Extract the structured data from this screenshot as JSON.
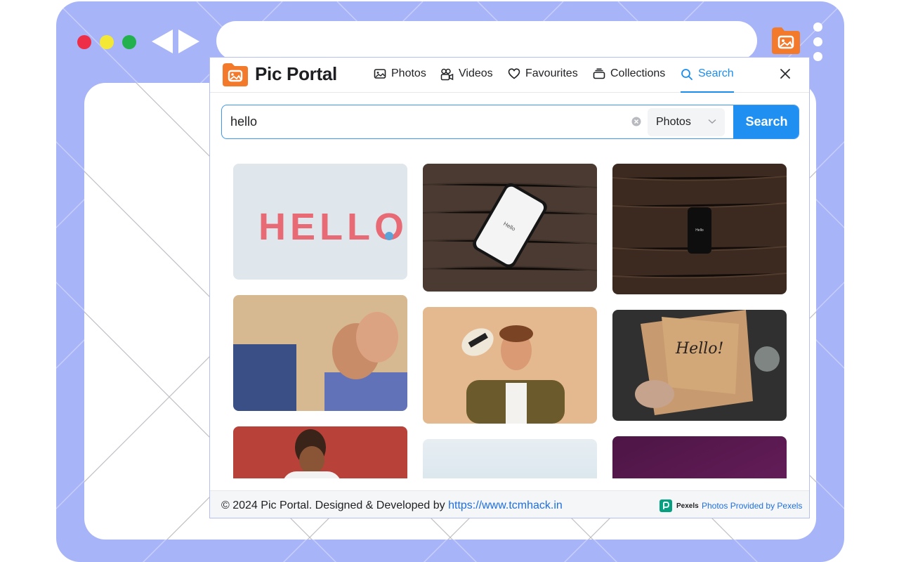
{
  "app": {
    "title": "Pic Portal"
  },
  "nav": {
    "tabs": [
      {
        "label": "Photos",
        "icon": "photo-icon",
        "active": false
      },
      {
        "label": "Videos",
        "icon": "video-icon",
        "active": false
      },
      {
        "label": "Favourites",
        "icon": "heart-icon",
        "active": false
      },
      {
        "label": "Collections",
        "icon": "collection-icon",
        "active": false
      },
      {
        "label": "Search",
        "icon": "search-icon",
        "active": true
      }
    ]
  },
  "search": {
    "query": "hello",
    "type_selected": "Photos",
    "button_label": "Search"
  },
  "results": [
    {
      "icon": "photo-hello-clay-letters",
      "text": "HELLO"
    },
    {
      "icon": "photo-phone-on-wood",
      "text": "Hello"
    },
    {
      "icon": "photo-dark-phone-on-wood",
      "text": "Hello"
    },
    {
      "icon": "photo-handshake",
      "text": ""
    },
    {
      "icon": "photo-man-with-hat",
      "text": ""
    },
    {
      "icon": "photo-hello-calligraphy",
      "text": "Hello!"
    },
    {
      "icon": "photo-man-red-background",
      "text": ""
    },
    {
      "icon": "photo-light-sky",
      "text": ""
    },
    {
      "icon": "photo-purple-gradient",
      "text": ""
    }
  ],
  "footer": {
    "copyright": "© 2024 Pic Portal. Designed & Developed by ",
    "link": "https://www.tcmhack.in",
    "pexels_name": "Pexels",
    "pexels_credit": "Photos Provided by Pexels"
  },
  "colors": {
    "accent": "#1f8ff2",
    "frame": "#a8b4f8",
    "logo": "#f27a2a"
  }
}
